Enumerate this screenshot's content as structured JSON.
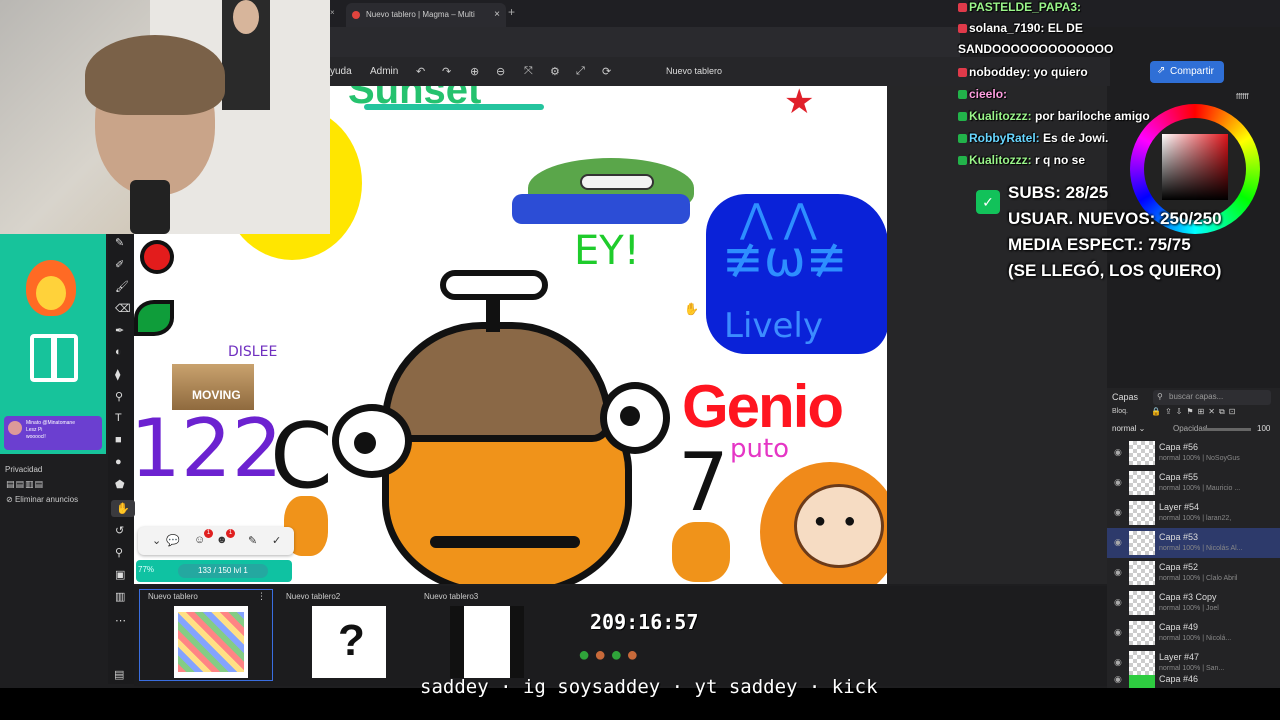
{
  "browser": {
    "tab_title": "Nuevo tablero | Magma – Multi",
    "tab_close": "×",
    "new_tab": "+",
    "left_close": "×"
  },
  "toolbar": {
    "menu_help": "yuda",
    "menu_admin": "Admin",
    "board_title": "Nuevo tablero",
    "share_label": "Compartir"
  },
  "chat": [
    {
      "user": "PASTELDE_PAPA3:",
      "message": "",
      "color": "#9af58a"
    },
    {
      "user": "solana_7190:",
      "message": "EL DE",
      "color": "#ffffff"
    },
    {
      "user": "",
      "message": "SANDOOOOOOOOOOOOO",
      "color": "#ffffff"
    },
    {
      "user": "noboddey:",
      "message": "yo quiero",
      "color": "#ffffff"
    },
    {
      "user": "cieelo:",
      "message": "",
      "color": "#ff9ee0"
    },
    {
      "user": "Kualitozzz:",
      "message": "por bariloche amigo",
      "color": "#9af58a"
    },
    {
      "user": "RobbyRatel:",
      "message": "Es de Jowi.",
      "color": "#68d6ff"
    },
    {
      "user": "Kualitozzz:",
      "message": "r q no se",
      "color": "#9af58a"
    }
  ],
  "goals": {
    "subs": "SUBS: 28/25",
    "new_users": "USUAR. NUEVOS: 250/250",
    "avg_viewers": "MEDIA ESPECT.: 75/75",
    "note": "(SE LLEGÓ, LOS QUIERO)"
  },
  "colorpicker": {
    "hex": "ffffff"
  },
  "promo": {
    "card_name": "Minato @Minatomane",
    "card_line2": "Lesz Pi",
    "card_line3": "woooocl!"
  },
  "left_panel": {
    "privacy_label": "Privacidad",
    "remove_ads_label": "Eliminar anuncios"
  },
  "canvas_text": {
    "ey": "EY!",
    "lively": "Lively",
    "genio": "Genio",
    "puto": "puto",
    "seven": "7",
    "disleee": "DISLEE",
    "moving": "MOVING",
    "num": "122",
    "c": "C"
  },
  "xp": {
    "level": "77%",
    "progress": "133 / 150",
    "level_tag": "lvl 1"
  },
  "boards": [
    {
      "name": "Nuevo tablero",
      "active": true
    },
    {
      "name": "Nuevo tablero2",
      "active": false
    },
    {
      "name": "Nuevo tablero3",
      "active": false
    }
  ],
  "timer": "209:16:57",
  "layers": {
    "header": "Capas",
    "search_placeholder": "buscar capas...",
    "lock_label": "Bloq.",
    "blend_mode": "normal",
    "opacity_label": "Opacidad",
    "opacity_value": "100",
    "rows": [
      {
        "name": "Capa #56",
        "meta": "normal 100% | NoSoyGus",
        "selected": false
      },
      {
        "name": "Capa #55",
        "meta": "normal 100% | Mauricio ...",
        "selected": false
      },
      {
        "name": "Layer #54",
        "meta": "normal 100% | laran22,",
        "selected": false
      },
      {
        "name": "Capa #53",
        "meta": "normal 100% | Nicolás Al...",
        "selected": true
      },
      {
        "name": "Capa #52",
        "meta": "normal 100% | Clalo Abril",
        "selected": false
      },
      {
        "name": "Capa #3 Copy",
        "meta": "normal 100% | Joel",
        "selected": false
      },
      {
        "name": "Capa #49",
        "meta": "normal 100% | Nicolá...",
        "selected": false
      },
      {
        "name": "Layer #47",
        "meta": "normal 100% | San...",
        "selected": false
      },
      {
        "name": "Capa #46",
        "meta": "",
        "selected": false
      }
    ]
  },
  "caption": "saddey · ig soysaddey · yt saddey · kick"
}
